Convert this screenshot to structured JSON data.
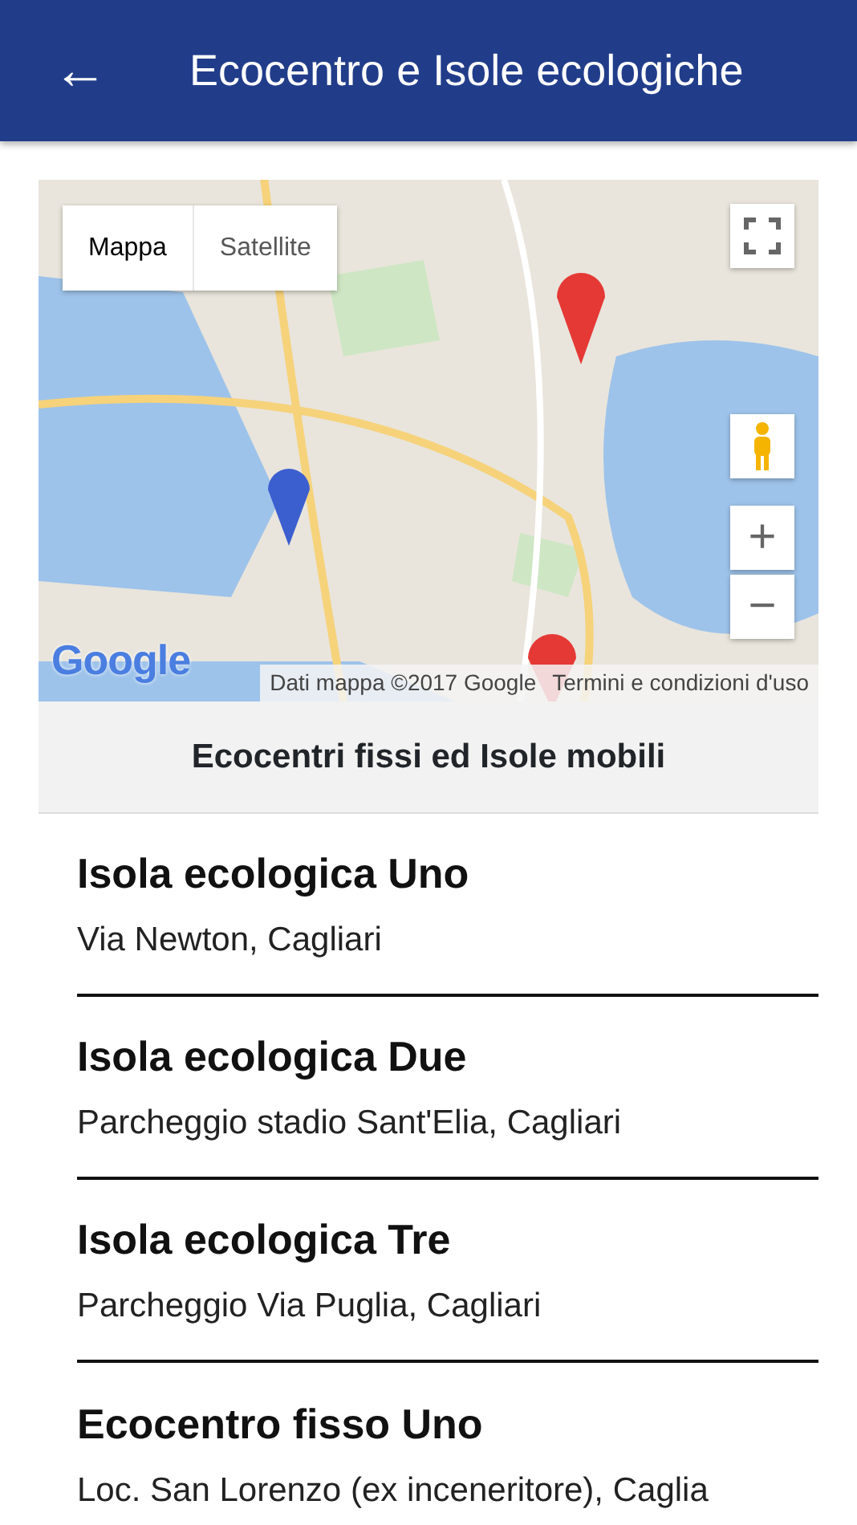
{
  "app_bar": {
    "back_icon": "←",
    "title": "Ecocentro e Isole ecologiche"
  },
  "map": {
    "kind": "picture",
    "map_types": [
      {
        "label": "Mappa",
        "selected": true
      },
      {
        "label": "Satellite",
        "selected": false
      }
    ],
    "zoom_in": "+",
    "zoom_out": "−",
    "logo": "Google",
    "attribution": "Dati mappa ©2017 Google",
    "terms": "Termini e condizioni d'uso"
  },
  "section_header": "Ecocentri fissi ed Isole mobili",
  "places": [
    {
      "name": "Isola ecologica Uno",
      "address": "Via Newton, Cagliari"
    },
    {
      "name": "Isola ecologica Due",
      "address": "Parcheggio stadio Sant'Elia, Cagliari"
    },
    {
      "name": "Isola ecologica Tre",
      "address": "Parcheggio Via Puglia, Cagliari"
    },
    {
      "name": "Ecocentro fisso Uno",
      "address": "Loc. San Lorenzo (ex inceneritore), Caglia"
    }
  ]
}
